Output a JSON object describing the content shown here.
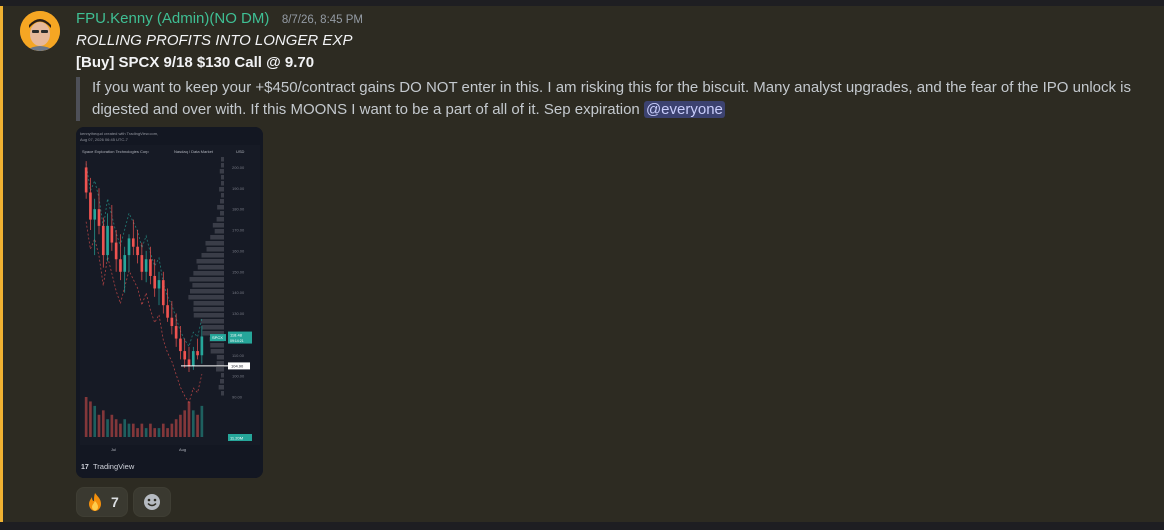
{
  "message": {
    "username": "FPU.Kenny (Admin)(NO DM)",
    "timestamp": "8/7/26, 8:45 PM",
    "line1": "ROLLING PROFITS INTO LONGER EXP",
    "line2": "[Buy] SPCX 9/18 $130 Call @ 9.70",
    "quote_text": "If you want to keep your +$450/contract gains DO NOT enter in this. I am risking this for the biscuit. Many analyst upgrades, and the fear of the IPO unlock is digested and over with. If this MOONS I want to be a part of all of it. Sep expiration ",
    "mention": "@everyone"
  },
  "chart_image": {
    "created_line1": "kennythequd created with TradingView.com,",
    "created_line2": "Aug 07, 2026 06:45 UTC-7",
    "symbol_title": "Space Exploration Technologies Corp",
    "badge": "Nasdaq / Data Market",
    "currency": "USD",
    "price_ticks": [
      "200.00",
      "190.00",
      "180.00",
      "170.00",
      "160.00",
      "150.00",
      "140.00",
      "130.00",
      "110.00",
      "100.00",
      "90.00"
    ],
    "last_symbol": "SPCX",
    "last_price": "118.48",
    "last_time": "09:14:21",
    "support_price": "104.90",
    "volume_label": "11.20M",
    "x_labels": [
      "Jul",
      "Aug"
    ],
    "brand": "TradingView",
    "colors": {
      "up": "#26a69a",
      "down": "#ef5350",
      "bg": "#131722"
    },
    "chart_data": {
      "type": "candlestick",
      "symbol": "SPCX",
      "ylim": [
        90,
        205
      ],
      "last_price": 118.48,
      "support_level": 104.9,
      "candles": [
        {
          "o": 200,
          "h": 203,
          "l": 185,
          "c": 188
        },
        {
          "o": 188,
          "h": 195,
          "l": 170,
          "c": 175
        },
        {
          "o": 175,
          "h": 185,
          "l": 158,
          "c": 180
        },
        {
          "o": 180,
          "h": 190,
          "l": 168,
          "c": 172
        },
        {
          "o": 172,
          "h": 176,
          "l": 152,
          "c": 158
        },
        {
          "o": 158,
          "h": 178,
          "l": 155,
          "c": 172
        },
        {
          "o": 172,
          "h": 182,
          "l": 160,
          "c": 164
        },
        {
          "o": 164,
          "h": 170,
          "l": 150,
          "c": 156
        },
        {
          "o": 156,
          "h": 168,
          "l": 146,
          "c": 150
        },
        {
          "o": 150,
          "h": 162,
          "l": 140,
          "c": 158
        },
        {
          "o": 158,
          "h": 168,
          "l": 150,
          "c": 166
        },
        {
          "o": 166,
          "h": 175,
          "l": 158,
          "c": 162
        },
        {
          "o": 162,
          "h": 170,
          "l": 154,
          "c": 158
        },
        {
          "o": 158,
          "h": 164,
          "l": 146,
          "c": 150
        },
        {
          "o": 150,
          "h": 160,
          "l": 145,
          "c": 156
        },
        {
          "o": 156,
          "h": 162,
          "l": 144,
          "c": 148
        },
        {
          "o": 148,
          "h": 156,
          "l": 138,
          "c": 142
        },
        {
          "o": 142,
          "h": 150,
          "l": 134,
          "c": 146
        },
        {
          "o": 146,
          "h": 150,
          "l": 130,
          "c": 134
        },
        {
          "o": 134,
          "h": 142,
          "l": 126,
          "c": 128
        },
        {
          "o": 128,
          "h": 136,
          "l": 120,
          "c": 124
        },
        {
          "o": 124,
          "h": 130,
          "l": 114,
          "c": 118
        },
        {
          "o": 118,
          "h": 124,
          "l": 108,
          "c": 112
        },
        {
          "o": 112,
          "h": 118,
          "l": 104,
          "c": 108
        },
        {
          "o": 108,
          "h": 114,
          "l": 102,
          "c": 105
        },
        {
          "o": 105,
          "h": 114,
          "l": 103,
          "c": 112
        },
        {
          "o": 112,
          "h": 118,
          "l": 108,
          "c": 110
        },
        {
          "o": 110,
          "h": 124,
          "l": 106,
          "c": 119
        }
      ],
      "volume": [
        9,
        8,
        7,
        5,
        6,
        4,
        5,
        4,
        3,
        4,
        3,
        3,
        2,
        3,
        2,
        3,
        2,
        2,
        3,
        2,
        3,
        4,
        5,
        6,
        8,
        6,
        5,
        7
      ]
    }
  },
  "reactions": [
    {
      "icon": "fire-emoji",
      "count": "7"
    },
    {
      "icon": "add-reaction-icon"
    }
  ]
}
